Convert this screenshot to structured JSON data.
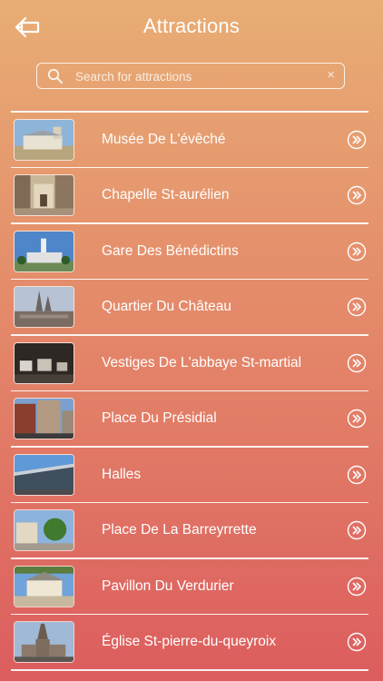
{
  "header": {
    "title": "Attractions",
    "back_icon": "back-arrow-icon"
  },
  "search": {
    "placeholder": "Search for attractions",
    "value": "",
    "icon": "search-icon",
    "clear_glyph": "×"
  },
  "attractions": [
    {
      "label": "Musée De L'évêché"
    },
    {
      "label": "Chapelle St-aurélien"
    },
    {
      "label": "Gare Des Bénédictins"
    },
    {
      "label": "Quartier Du Château"
    },
    {
      "label": "Vestiges De L'abbaye St-martial"
    },
    {
      "label": "Place Du Présidial"
    },
    {
      "label": "Halles"
    },
    {
      "label": "Place De La Barreyrrette"
    },
    {
      "label": "Pavillon Du Verdurier"
    },
    {
      "label": "Église St-pierre-du-queyroix"
    }
  ],
  "colors": {
    "gradient_top": "#e8ad74",
    "gradient_bottom": "#dc5d5e",
    "text": "#ffffff"
  }
}
